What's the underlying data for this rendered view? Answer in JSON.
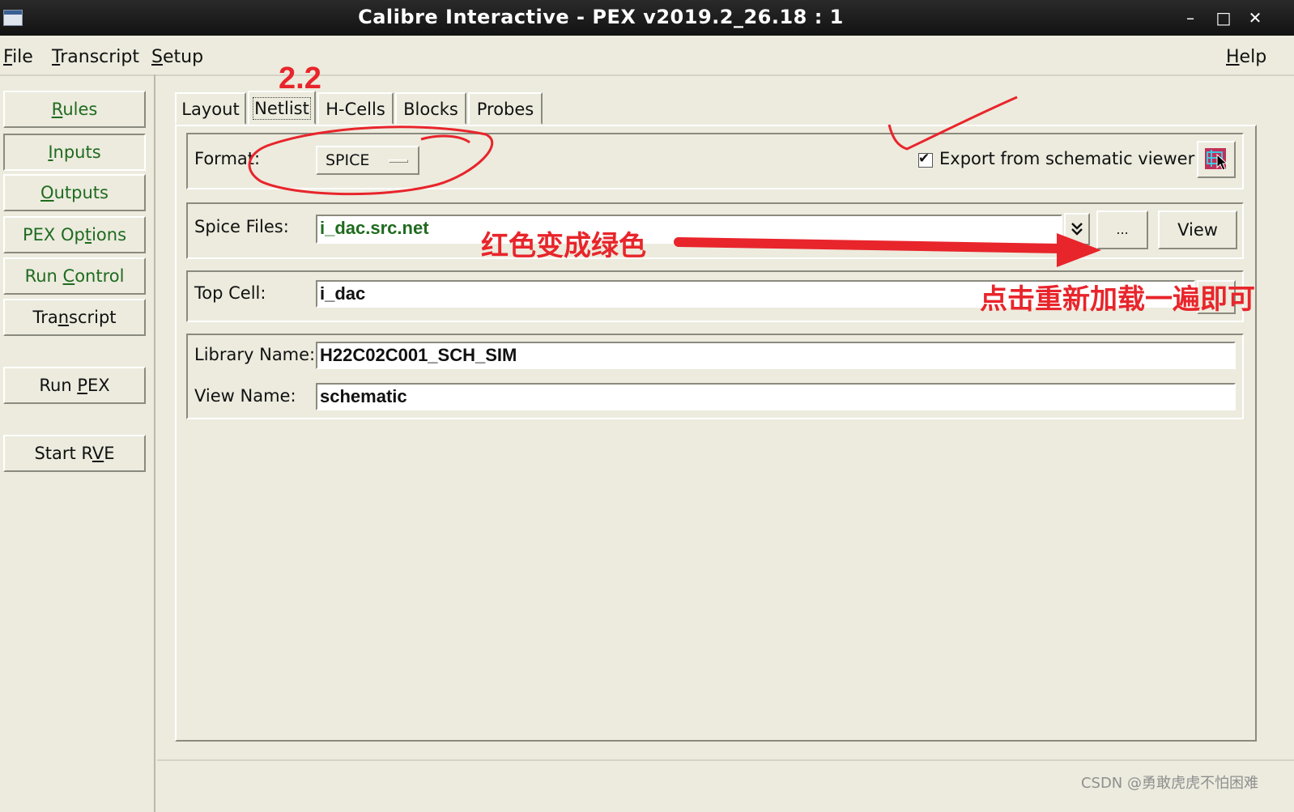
{
  "window": {
    "title": "Calibre Interactive - PEX v2019.2_26.18 : 1",
    "minimize": "–",
    "maximize": "□",
    "close": "✕"
  },
  "menubar": {
    "file": {
      "mn": "F",
      "rest": "ile"
    },
    "transcript": {
      "mn": "T",
      "rest": "ranscript"
    },
    "setup": {
      "mn": "S",
      "rest": "etup"
    },
    "help": {
      "mn": "H",
      "rest": "elp"
    }
  },
  "sidebar": {
    "rules": {
      "pre": "",
      "mn": "R",
      "post": "ules"
    },
    "inputs": {
      "pre": "",
      "mn": "I",
      "post": "nputs"
    },
    "outputs": {
      "pre": "",
      "mn": "O",
      "post": "utputs"
    },
    "pex_options": {
      "pre": "PEX Op",
      "mn": "t",
      "post": "ions"
    },
    "run_control": {
      "pre": "Run ",
      "mn": "C",
      "post": "ontrol"
    },
    "transcript": {
      "pre": "Tra",
      "mn": "n",
      "post": "script"
    },
    "run_pex": {
      "pre": "Run ",
      "mn": "P",
      "post": "EX"
    },
    "start_rve": {
      "pre": "Start R",
      "mn": "V",
      "post": "E"
    }
  },
  "tabs": [
    "Layout",
    "Netlist",
    "H-Cells",
    "Blocks",
    "Probes"
  ],
  "netlist": {
    "format_label": "Format:",
    "format_value": "SPICE",
    "export_label": "Export from schematic viewer",
    "export_checked": true,
    "spice_files_label": "Spice Files:",
    "spice_files_value": "i_dac.src.net",
    "spice_files_color": "#1f6b1f",
    "browse_label": "...",
    "view_label": "View",
    "top_cell_label": "Top Cell:",
    "top_cell_value": "i_dac",
    "library_name_label": "Library Name:",
    "library_name_value": "H22C02C001_SCH_SIM",
    "view_name_label": "View Name:",
    "view_name_value": "schematic"
  },
  "annotations": {
    "step": "2.2",
    "red_to_green": "红色变成绿色",
    "reload_hint": "点击重新加载一遍即可",
    "accent_color": "#e8252b"
  },
  "watermark": "CSDN @勇敢虎虎不怕困难",
  "icons": [
    "app-window-icon",
    "dropdown-indicator-icon",
    "checkbox-check-icon",
    "schematic-viewer-icon",
    "double-chevron-down-icon",
    "cursor-arrow-icon"
  ]
}
